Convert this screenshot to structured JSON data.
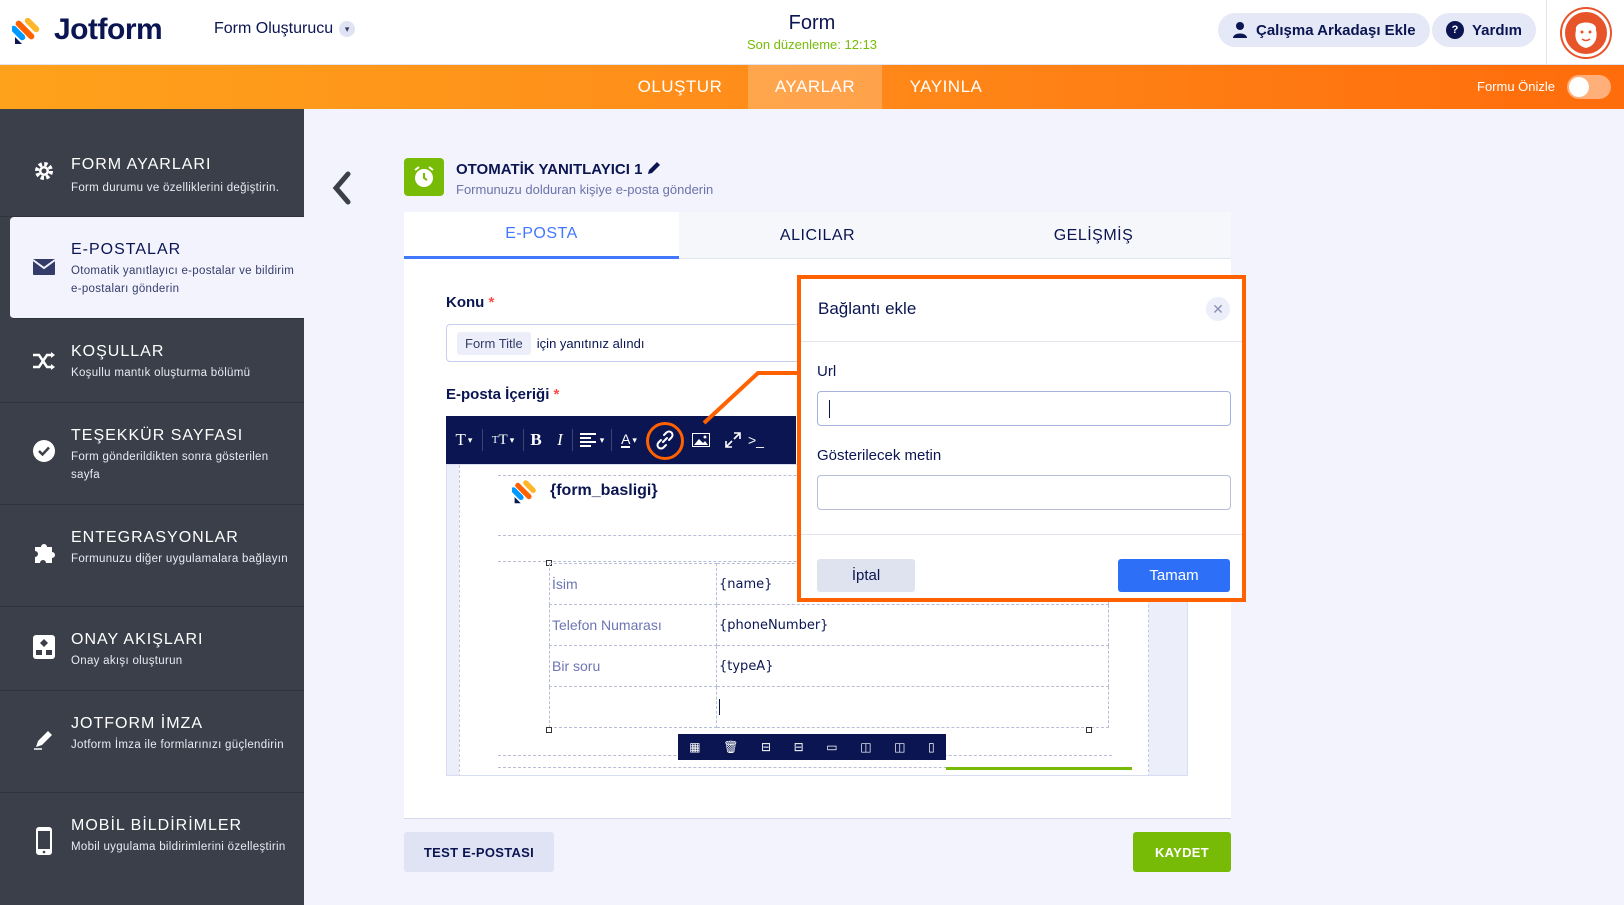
{
  "header": {
    "logo_text": "Jotform",
    "builder_label": "Form Oluşturucu",
    "form_title": "Form",
    "last_edited": "Son düzenleme: 12:13",
    "invite_label": "Çalışma Arkadaşı Ekle",
    "help_label": "Yardım"
  },
  "nav": {
    "tabs": [
      "OLUŞTUR",
      "AYARLAR",
      "YAYINLA"
    ],
    "active_tab": "AYARLAR",
    "preview_label": "Formu Önizle",
    "preview_on": false
  },
  "sidebar": {
    "items": [
      {
        "title": "FORM AYARLARI",
        "desc": "Form durumu ve özelliklerini değiştirin.",
        "icon": "gear-icon"
      },
      {
        "title": "E-POSTALAR",
        "desc": "Otomatik yanıtlayıcı e-postalar ve bildirim e-postaları gönderin",
        "icon": "envelope-icon",
        "active": true
      },
      {
        "title": "KOŞULLAR",
        "desc": "Koşullu mantık oluşturma bölümü",
        "icon": "shuffle-icon"
      },
      {
        "title": "TEŞEKKÜR SAYFASI",
        "desc": "Form gönderildikten sonra gösterilen sayfa",
        "icon": "check-circle-icon"
      },
      {
        "title": "ENTEGRASYONLAR",
        "desc": "Formunuzu diğer uygulamalara bağlayın",
        "icon": "puzzle-icon"
      },
      {
        "title": "ONAY AKIŞLARI",
        "desc": "Onay akışı oluşturun",
        "icon": "flow-icon"
      },
      {
        "title": "JOTFORM İMZA",
        "desc": "Jotform İmza ile formlarınızı güçlendirin",
        "icon": "pen-icon"
      },
      {
        "title": "MOBİL BİLDİRİMLER",
        "desc": "Mobil uygulama bildirimlerini özelleştirin",
        "icon": "phone-icon"
      }
    ]
  },
  "rule": {
    "title": "OTOMATİK YANITLAYICI 1",
    "subtitle": "Formunuzu dolduran kişiye e-posta gönderin"
  },
  "tabs": [
    "E-POSTA",
    "ALICILAR",
    "GELİŞMİŞ"
  ],
  "active_tab": "E-POSTA",
  "subject": {
    "label": "Konu",
    "required_mark": "*",
    "chip": "Form Title",
    "text": "için yanıtınız alındı"
  },
  "content": {
    "label": "E-posta İçeriği",
    "required_mark": "*",
    "form_heading": "{form_basligi}",
    "rows": [
      {
        "key": "İsim",
        "value": "{name}"
      },
      {
        "key": "Telefon Numarası",
        "value": "{phoneNumber}"
      },
      {
        "key": "Bir soru",
        "value": "{typeA}"
      },
      {
        "key": "",
        "value": ""
      }
    ]
  },
  "footer": {
    "test_label": "TEST E-POSTASI",
    "save_label": "KAYDET"
  },
  "modal": {
    "title": "Bağlantı ekle",
    "url_label": "Url",
    "url_value": "",
    "text_label": "Gösterilecek metin",
    "text_value": "",
    "cancel_label": "İptal",
    "ok_label": "Tamam"
  },
  "colors": {
    "accent_orange": "#ff6100",
    "primary_blue": "#2d6ff7",
    "success_green": "#78bb07",
    "navy": "#0a1551"
  }
}
